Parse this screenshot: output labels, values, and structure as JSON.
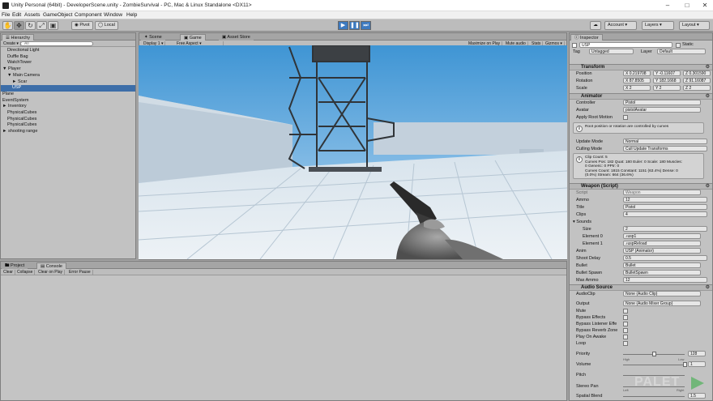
{
  "window": {
    "title": "Unity Personal (64bit) - DeveloperScene.unity - ZombieSurvival - PC, Mac & Linux Standalone <DX11>"
  },
  "menu": [
    "File",
    "Edit",
    "Assets",
    "GameObject",
    "Component",
    "Window",
    "Help"
  ],
  "toolbar": {
    "pivot": "Pivot",
    "local": "Local",
    "account": "Account",
    "layers": "Layers",
    "layout": "Layout"
  },
  "hierarchy": {
    "tab": "Hierarchy",
    "create": "Create",
    "search_placeholder": "All",
    "items": [
      {
        "label": "Directional Light",
        "indent": 1
      },
      {
        "label": "Duffle Bag",
        "indent": 1
      },
      {
        "label": "WatchTower",
        "indent": 1
      },
      {
        "label": "Player",
        "indent": 0,
        "arrow": "▼"
      },
      {
        "label": "Main Camera",
        "indent": 1,
        "arrow": "▼"
      },
      {
        "label": "Scar",
        "indent": 2,
        "arrow": "►"
      },
      {
        "label": "USP",
        "indent": 2,
        "selected": true
      },
      {
        "label": "Plane",
        "indent": 0
      },
      {
        "label": "EventSystem",
        "indent": 0
      },
      {
        "label": "Inventory",
        "indent": 0,
        "arrow": "►"
      },
      {
        "label": "PhysicalCubes",
        "indent": 1
      },
      {
        "label": "PhysicalCubes",
        "indent": 1
      },
      {
        "label": "PhysicalCubes",
        "indent": 1
      },
      {
        "label": "shooting range",
        "indent": 0,
        "arrow": "►"
      }
    ]
  },
  "game": {
    "tabs": [
      "Scene",
      "Game",
      "Asset Store"
    ],
    "display": "Display 1",
    "aspect": "Free Aspect",
    "options": [
      "Maximize on Play",
      "Mute audio",
      "Stats",
      "Gizmos"
    ]
  },
  "project": {
    "tabs": [
      "Project",
      "Console"
    ],
    "buttons": [
      "Clear",
      "Collapse",
      "Clear on Play",
      "Error Pause"
    ]
  },
  "inspector": {
    "tab": "Inspector",
    "name": "USP",
    "static": "Static",
    "tag_label": "Tag",
    "tag": "Untagged",
    "layer_label": "Layer",
    "layer": "Default",
    "transform": {
      "title": "Transform",
      "position_label": "Position",
      "position": [
        "0.219708",
        "-0.11607",
        "0.301590"
      ],
      "rotation_label": "Rotation",
      "rotation": [
        "87.8505",
        "182.1668",
        "91.16087"
      ],
      "scale_label": "Scale",
      "scale": [
        "2",
        "2",
        "2"
      ]
    },
    "animator": {
      "title": "Animator",
      "controller_label": "Controller",
      "controller": "Pistol",
      "avatar_label": "Avatar",
      "avatar": "pistolAvatar",
      "root_motion_label": "Apply Root Motion",
      "root_info": "Root position or rotation are controlled by curves",
      "update_mode_label": "Update Mode",
      "update_mode": "Normal",
      "culling_label": "Culling Mode",
      "culling": "Cull Update Transforms",
      "clip_info": "Clip Count: 5\nCurves Pos: 182 Quat: 180 Euler: 0 Scale: 180 Muscles:\n0 Generic: 0 PPtr: 0\nCurves Count: 1815 Constant: 1151 (63.4%) Dense: 0\n(0.0%) Stream: 664 (36.6%)"
    },
    "weapon": {
      "title": "Weapon (Script)",
      "script_label": "Script",
      "script": "Weapon",
      "ammo_label": "Ammo",
      "ammo": "12",
      "title_label": "Title",
      "title_value": "Pistol",
      "clips_label": "Clips",
      "clips": "4",
      "sounds_label": "Sounds",
      "size_label": "Size",
      "size": "2",
      "e0_label": "Element 0",
      "e0": "usp1",
      "e1_label": "Element 1",
      "e1": "uspReload",
      "anim_label": "Anim",
      "anim": "USP (Animator)",
      "shoot_delay_label": "Shoot Delay",
      "shoot_delay": "0.5",
      "bullet_label": "Bullet",
      "bullet": "Bullet",
      "bullet_spawn_label": "Bullet Spawn",
      "bullet_spawn": "BulletSpawn",
      "max_ammo_label": "Max Ammo",
      "max_ammo": "12"
    },
    "audio": {
      "title": "Audio Source",
      "clip_label": "AudioClip",
      "clip": "None (Audio Clip)",
      "output_label": "Output",
      "output": "None (Audio Mixer Group)",
      "mute_label": "Mute",
      "bypass_effects_label": "Bypass Effects",
      "bypass_listener_label": "Bypass Listener Effe",
      "bypass_reverb_label": "Bypass Reverb Zone",
      "play_awake_label": "Play On Awake",
      "loop_label": "Loop",
      "priority_label": "Priority",
      "priority": "128",
      "high": "High",
      "low": "Low",
      "volume_label": "Volume",
      "volume": "1",
      "pitch_label": "Pitch",
      "stereo_label": "Stereo Pan",
      "left": "Left",
      "right": "Right",
      "spatial_label": "Spatial Blend",
      "spatial": "1.5"
    }
  },
  "watermark": "PALET"
}
